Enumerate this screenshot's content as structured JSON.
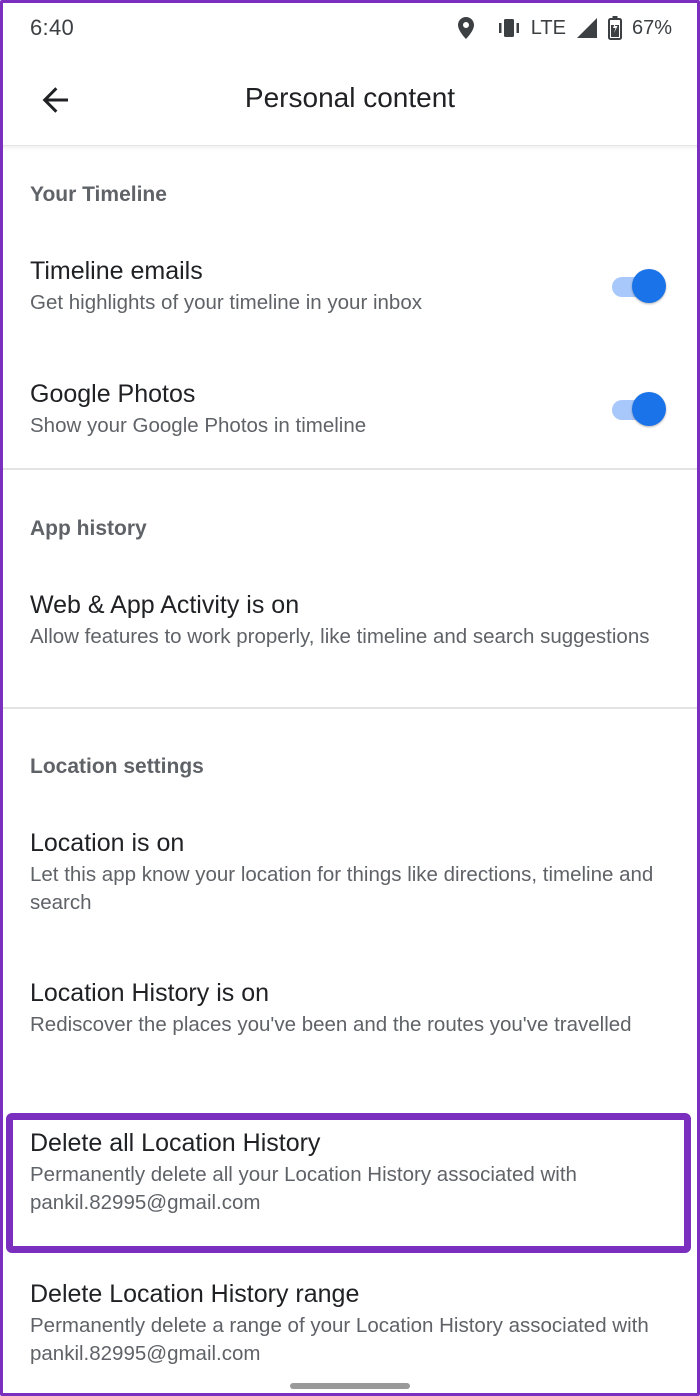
{
  "status_bar": {
    "time": "6:40",
    "network": "LTE",
    "battery": "67%",
    "icons": [
      "location-pin-icon",
      "vibrate-icon",
      "signal-icon",
      "battery-icon"
    ]
  },
  "app_bar": {
    "title": "Personal content",
    "back_icon": "arrow-back-icon"
  },
  "sections": {
    "timeline": {
      "header": "Your Timeline",
      "items": [
        {
          "title": "Timeline emails",
          "subtitle": "Get highlights of your timeline in your inbox",
          "toggle_on": true
        },
        {
          "title": "Google Photos",
          "subtitle": "Show your Google Photos in timeline",
          "toggle_on": true
        }
      ]
    },
    "app_history": {
      "header": "App history",
      "items": [
        {
          "title": "Web & App Activity is on",
          "subtitle": "Allow features to work properly, like timeline and search suggestions"
        }
      ]
    },
    "location": {
      "header": "Location settings",
      "items": [
        {
          "title": "Location is on",
          "subtitle": "Let this app know your location for things like directions, timeline and search"
        },
        {
          "title": "Location History is on",
          "subtitle": "Rediscover the places you've been and the routes you've travelled"
        },
        {
          "title": "Delete all Location History",
          "subtitle": "Permanently delete all your Location History associated with pankil.82995@gmail.com"
        },
        {
          "title": "Delete Location History range",
          "subtitle": "Permanently delete a range of your Location History associated with pankil.82995@gmail.com"
        }
      ]
    }
  },
  "colors": {
    "accent": "#1a73e8",
    "toggle_track": "#a8c7fa",
    "highlight_border": "#7b2fbf",
    "secondary_text": "#5f6368"
  }
}
